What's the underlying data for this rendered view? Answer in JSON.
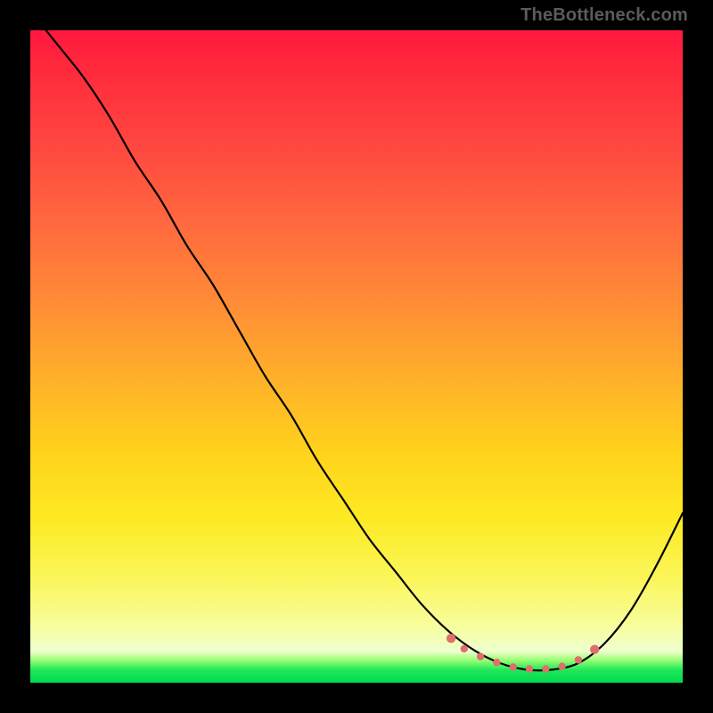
{
  "watermark": "TheBottleneck.com",
  "colors": {
    "frame": "#000000",
    "marker": "#de6f6a",
    "curve": "#000000"
  },
  "chart_data": {
    "type": "line",
    "title": "",
    "xlabel": "",
    "ylabel": "",
    "xlim": [
      0,
      100
    ],
    "ylim": [
      0,
      100
    ],
    "grid": false,
    "legend": false,
    "series": [
      {
        "name": "bottleneck-curve",
        "x": [
          0,
          4,
          8,
          12,
          16,
          20,
          24,
          28,
          32,
          36,
          40,
          44,
          48,
          52,
          56,
          60,
          64,
          68,
          72,
          76,
          80,
          84,
          88,
          92,
          96,
          100
        ],
        "values": [
          103,
          98,
          93,
          87,
          80,
          74,
          67,
          61,
          54,
          47,
          41,
          34,
          28,
          22,
          17,
          12,
          8,
          5,
          3,
          2,
          2,
          3,
          6,
          11,
          18,
          26
        ]
      }
    ],
    "markers": {
      "name": "valley-dots",
      "x": [
        64.5,
        66.5,
        69.0,
        71.5,
        74.0,
        76.5,
        79.0,
        81.5,
        84.0,
        86.5
      ],
      "values": [
        6.8,
        5.2,
        4.0,
        3.1,
        2.4,
        2.1,
        2.1,
        2.5,
        3.5,
        5.1
      ]
    },
    "gradient_bands": [
      {
        "pct": 0,
        "color": "#ff183f",
        "label": "red"
      },
      {
        "pct": 30,
        "color": "#ff6a3e",
        "label": "orange"
      },
      {
        "pct": 65,
        "color": "#ffd31b",
        "label": "yellow"
      },
      {
        "pct": 92,
        "color": "#f4ffb8",
        "label": "cream"
      },
      {
        "pct": 100,
        "color": "#00d94e",
        "label": "green"
      }
    ]
  }
}
